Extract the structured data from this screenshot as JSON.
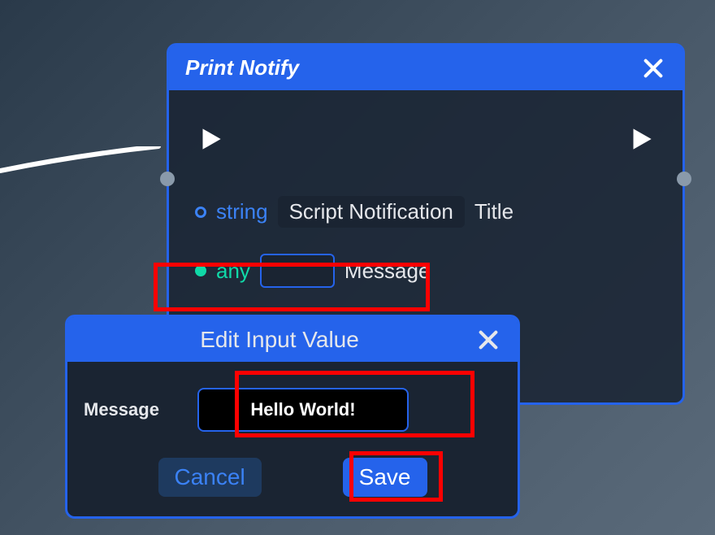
{
  "node": {
    "title": "Print Notify",
    "params": [
      {
        "type_label": "string",
        "value": "Script Notification",
        "name": "Title"
      },
      {
        "type_label": "any",
        "value": "",
        "name": "Message"
      }
    ]
  },
  "dialog": {
    "title": "Edit Input Value",
    "field_label": "Message",
    "field_value": "Hello World!",
    "cancel_label": "Cancel",
    "save_label": "Save"
  },
  "icons": {
    "close": "close-icon",
    "play": "play-icon"
  }
}
